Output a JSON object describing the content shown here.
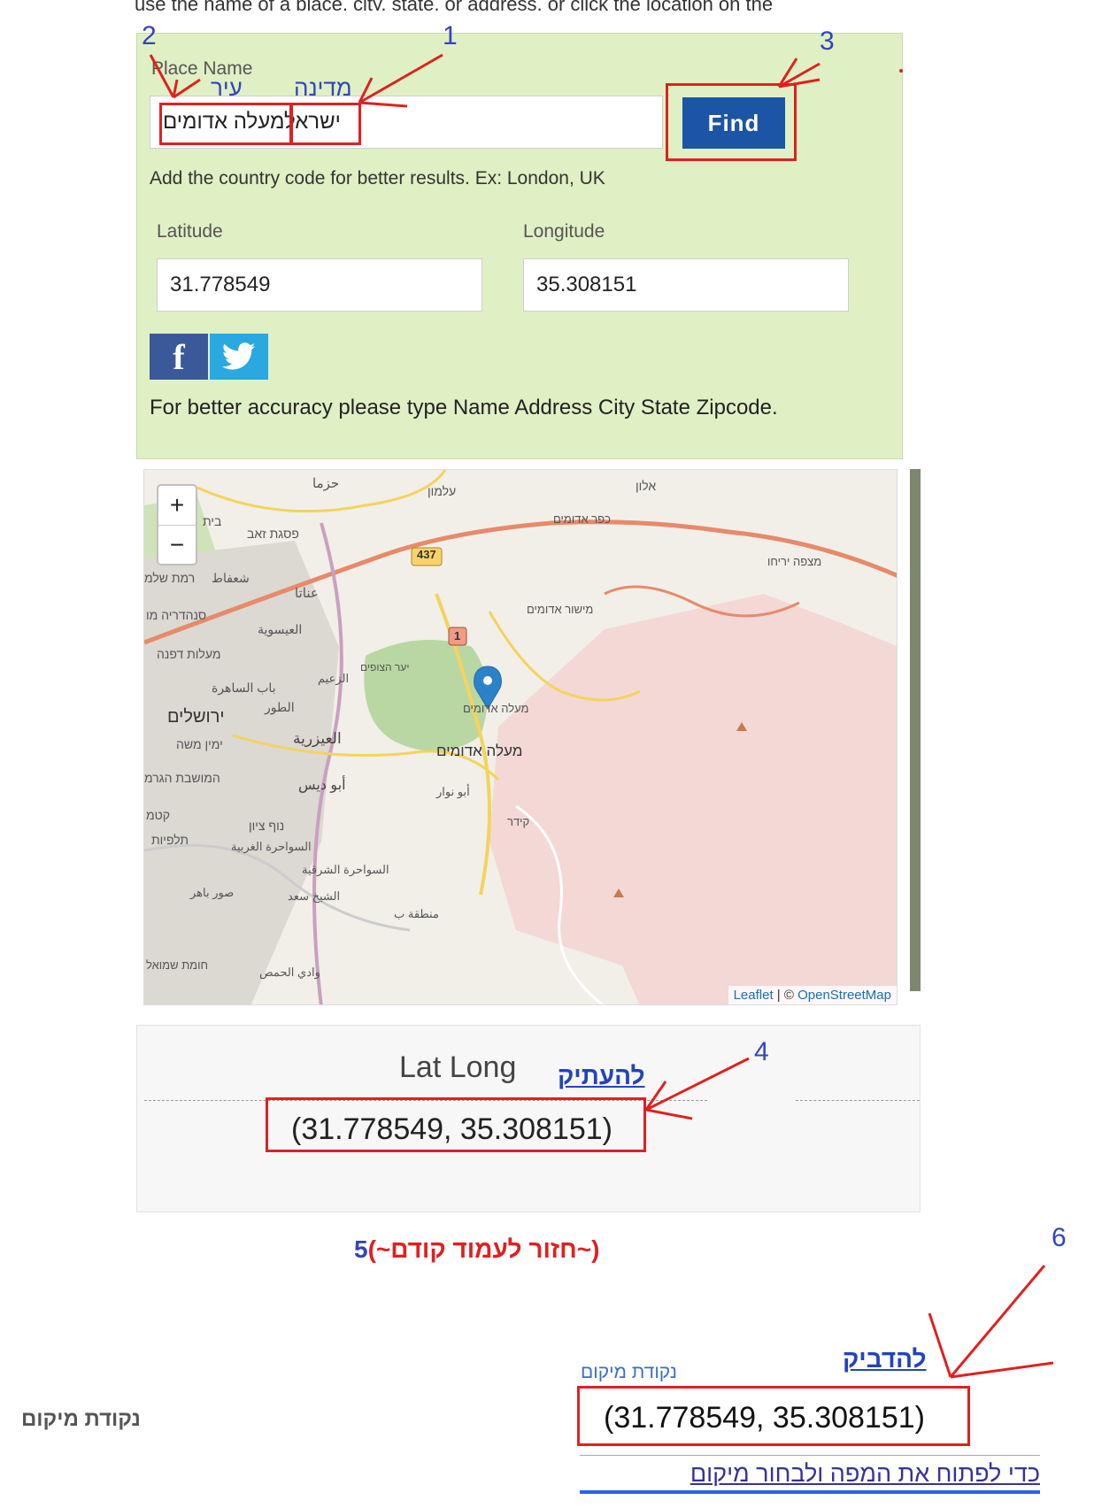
{
  "top_clipped_text": "use the name of a place, city, state, or address, or click the location on the",
  "form": {
    "place_label": "Place Name",
    "place_value_country": "ישראל",
    "place_value_city": "מעלה אדומים",
    "find_label": "Find",
    "country_code_hint": "Add the country code for better results. Ex: London, UK",
    "latitude_label": "Latitude",
    "latitude_value": "31.778549",
    "longitude_label": "Longitude",
    "longitude_value": "35.308151",
    "accuracy_hint": "For better accuracy please type Name Address City State Zipcode."
  },
  "share": {
    "facebook_icon": "f",
    "twitter_icon": "twitter-bird"
  },
  "annotations": {
    "num1": "1",
    "num2": "2",
    "num3": "3",
    "num4": "4",
    "num5": "5",
    "num6": "6",
    "label_country": "מדינה",
    "label_city": "עיר",
    "copy": "להעתיק",
    "back": "(~חזור לעמוד קודם~)",
    "paste": "להדביק",
    "location_point_small": "נקודת מיקום"
  },
  "map": {
    "zoom_in": "+",
    "zoom_out": "−",
    "attribution_leaflet": "Leaflet",
    "attribution_sep": " | © ",
    "attribution_osm": "OpenStreetMap",
    "road_437": "437",
    "road_1": "1",
    "labels": [
      "حزما",
      "עלמון",
      "אלון",
      "בית",
      "פסגת זאב",
      "כפר אדומים",
      "רמת שלמ",
      "شعفاط",
      "عناتا",
      "מצפה יריחו",
      "סנהדריה מו",
      "العيسوية",
      "מישור אדומים",
      "מעלות דפנה",
      "יער הצופים",
      "باب الساهرة",
      "الزعيم",
      "ירושלים",
      "الطور",
      "מעלה אדומים",
      "ימין משה",
      "العيزرية",
      "מעלה אדומים",
      "המושבת הגרמ",
      "أبو ديس",
      "أبو نوار",
      "קטמ",
      "נוף ציון",
      "קידר",
      "תלפיות",
      "السواحرة الغربية",
      "السواحرة الشرقية",
      "صور باهر",
      "الشيخ سعد",
      "منطقة ب",
      "חומת שמואל",
      "وادي الحمص"
    ]
  },
  "result": {
    "title": "Lat Long",
    "coords": "(31.778549, 35.308151)"
  },
  "bottom": {
    "left_label": "נקודת מיקום",
    "coords": "(31.778549, 35.308151)",
    "open_map_link": "כדי לפתוח את המפה ולבחור מיקום"
  },
  "colors": {
    "panel_bg": "#dff0c4",
    "find_bg": "#1c55a5",
    "annot_red": "#e02020",
    "annot_blue": "#3344bb"
  }
}
